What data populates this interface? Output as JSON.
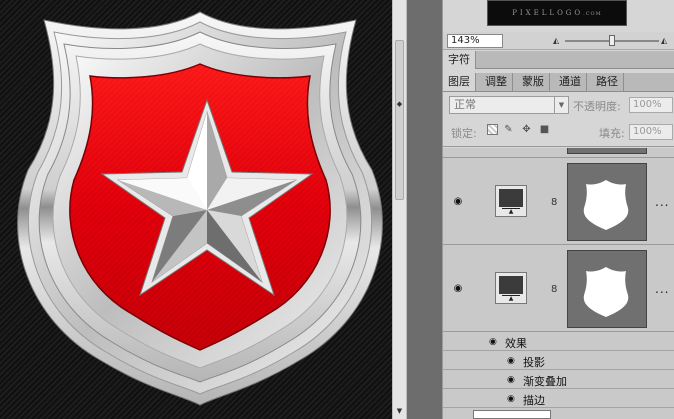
{
  "navigator": {
    "thumb_text": "PIXELLOGO",
    "thumb_sub": ".COM",
    "zoom_value": "143%"
  },
  "tabs_top": [
    {
      "label": "字符",
      "active": true
    }
  ],
  "tabs_panel": [
    {
      "label": "图层",
      "active": true
    },
    {
      "label": "调整",
      "active": false
    },
    {
      "label": "蒙版",
      "active": false
    },
    {
      "label": "通道",
      "active": false
    },
    {
      "label": "路径",
      "active": false
    }
  ],
  "layer_options": {
    "blend_mode": "正常",
    "opacity_label": "不透明度:",
    "opacity_value": "100%",
    "lock_label": "锁定:",
    "fill_label": "填充:",
    "fill_value": "100%"
  },
  "layers": [
    {
      "visible": true,
      "has_mask": true,
      "more": "..."
    },
    {
      "visible": true,
      "has_mask": true,
      "more": "..."
    }
  ],
  "effects": {
    "header": "效果",
    "items": [
      "投影",
      "渐变叠加",
      "描边"
    ]
  },
  "colors": {
    "shield_red": "#e3000b",
    "canvas_bg": "#151515",
    "panel_bg": "#d6d6d6"
  },
  "icons": [
    "eye-icon",
    "chain-link-icon",
    "lock-transparency-icon",
    "brush-icon",
    "move-icon",
    "lock-icon",
    "scroll-up-icon",
    "scroll-down-icon",
    "mountain-small-icon",
    "mountain-large-icon"
  ]
}
